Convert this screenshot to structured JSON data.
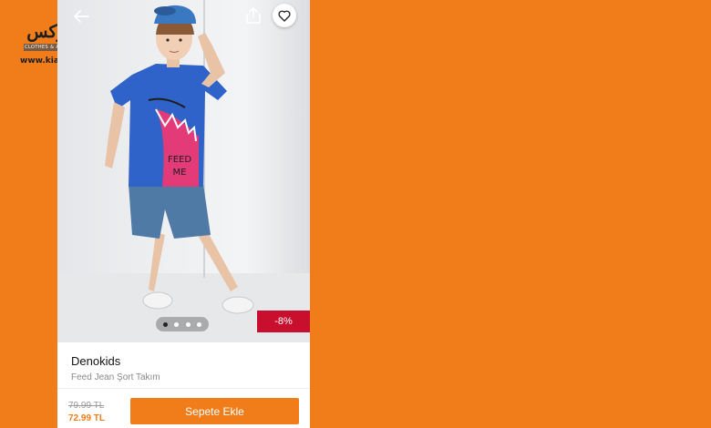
{
  "watermark": {
    "logo_text": "کیالوکس",
    "tagline": "CLOTHES & ACCESSORIES",
    "url": "www.kialux.com"
  },
  "colors": {
    "accent": "#f07d1a",
    "discount_badge": "#c8102e"
  },
  "top_bar": {
    "back_icon": "arrow-left-icon",
    "share_icon": "share-icon",
    "favorite_icon": "heart-icon"
  },
  "gallery": {
    "image_count": 4,
    "active_index": 0,
    "shirt_print": "FEED ME",
    "discount_label": "-8%"
  },
  "product": {
    "brand": "Denokids",
    "name": "Feed Jean Şort Takım",
    "old_price": "79.99 TL",
    "new_price": "72.99 TL",
    "add_to_cart_label": "Sepete Ekle"
  }
}
